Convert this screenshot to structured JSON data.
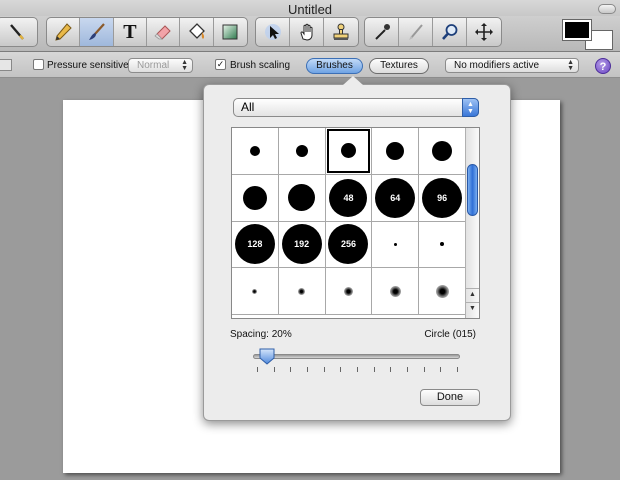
{
  "window": {
    "title": "Untitled"
  },
  "toolbar": {
    "groups": [
      {
        "tools": [
          {
            "name": "line-tool",
            "icon": "line-icon",
            "active": false
          }
        ]
      },
      {
        "tools": [
          {
            "name": "pencil-tool",
            "icon": "pencil-icon",
            "active": false
          },
          {
            "name": "brush-tool",
            "icon": "brush-icon",
            "active": true
          },
          {
            "name": "text-tool",
            "icon": "text-icon",
            "glyph": "T",
            "active": false
          },
          {
            "name": "eraser-tool",
            "icon": "eraser-icon",
            "active": false
          },
          {
            "name": "fill-tool",
            "icon": "paint-bucket-icon",
            "active": false
          },
          {
            "name": "gradient-tool",
            "icon": "gradient-icon",
            "active": false
          }
        ]
      },
      {
        "tools": [
          {
            "name": "select-tool",
            "icon": "arrow-cursor-icon",
            "active": false
          },
          {
            "name": "hand-tool",
            "icon": "hand-icon",
            "active": false
          },
          {
            "name": "stamp-tool",
            "icon": "stamp-icon",
            "active": false
          }
        ]
      },
      {
        "tools": [
          {
            "name": "eyedropper-tool",
            "icon": "eyedropper-icon",
            "active": false
          },
          {
            "name": "smudge-tool",
            "icon": "smudge-icon",
            "active": false
          },
          {
            "name": "zoom-tool",
            "icon": "magnifier-icon",
            "active": false
          },
          {
            "name": "move-tool",
            "icon": "move-arrows-icon",
            "active": false
          }
        ]
      }
    ],
    "colors": {
      "foreground": "#000000",
      "background": "#ffffff"
    }
  },
  "options": {
    "pressure_label": "Pressure sensitive:",
    "pressure_checked": false,
    "pressure_mode": "Normal",
    "brush_scaling_label": "Brush scaling",
    "brush_scaling_checked": true,
    "brushes_label": "Brushes",
    "textures_label": "Textures",
    "modifiers_value": "No modifiers active",
    "help_label": "?"
  },
  "brush_panel": {
    "category": "All",
    "brushes": [
      {
        "size": 10,
        "label": "",
        "selected": false
      },
      {
        "size": 12,
        "label": "",
        "selected": false
      },
      {
        "size": 15,
        "label": "",
        "selected": true
      },
      {
        "size": 18,
        "label": "",
        "selected": false
      },
      {
        "size": 20,
        "label": "",
        "selected": false
      },
      {
        "size": 24,
        "label": "",
        "selected": false
      },
      {
        "size": 27,
        "label": "",
        "selected": false
      },
      {
        "size": 38,
        "label": "48",
        "selected": false
      },
      {
        "size": 40,
        "label": "64",
        "selected": false
      },
      {
        "size": 40,
        "label": "96",
        "selected": false
      },
      {
        "size": 40,
        "label": "128",
        "selected": false
      },
      {
        "size": 40,
        "label": "192",
        "selected": false
      },
      {
        "size": 40,
        "label": "256",
        "selected": false
      },
      {
        "size": 3,
        "label": "",
        "selected": false
      },
      {
        "size": 4,
        "label": "",
        "selected": false
      },
      {
        "size": 5,
        "label": "",
        "selected": false,
        "soft": true
      },
      {
        "size": 7,
        "label": "",
        "selected": false,
        "soft": true
      },
      {
        "size": 9,
        "label": "",
        "selected": false,
        "soft": true
      },
      {
        "size": 11,
        "label": "",
        "selected": false,
        "soft": true
      },
      {
        "size": 13,
        "label": "",
        "selected": false,
        "soft": true
      }
    ],
    "spacing_label": "Spacing: 20%",
    "spacing_value": 0.04,
    "brush_name": "Circle (015)",
    "done_label": "Done"
  }
}
